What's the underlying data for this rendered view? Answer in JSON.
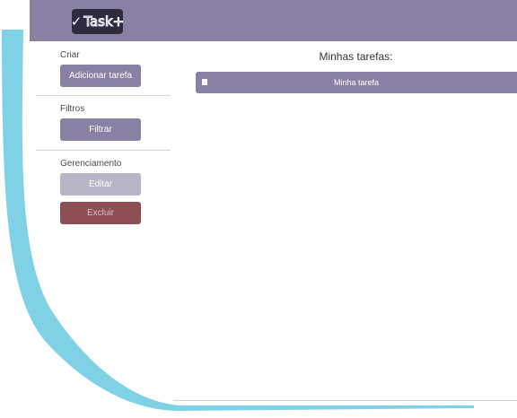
{
  "colors": {
    "accent": "#8a80a3",
    "logo_bg": "#2f2b3f",
    "edit_disabled": "#bab4c9",
    "delete": "#8d4f52",
    "swoosh": "#7fd2e6"
  },
  "header": {
    "logo": {
      "check_icon": "checkmark-icon",
      "text": "Task+"
    }
  },
  "sidebar": {
    "create": {
      "label": "Criar",
      "button": "Adicionar tarefa"
    },
    "filters": {
      "label": "Filtros",
      "button": "Filtrar"
    },
    "management": {
      "label": "Gerenciamento",
      "edit_button": "Editar",
      "delete_button": "Excluir"
    }
  },
  "main": {
    "title": "Minhas tarefas:",
    "tasks": [
      {
        "name": "Minha tarefa",
        "checked": false
      }
    ]
  }
}
